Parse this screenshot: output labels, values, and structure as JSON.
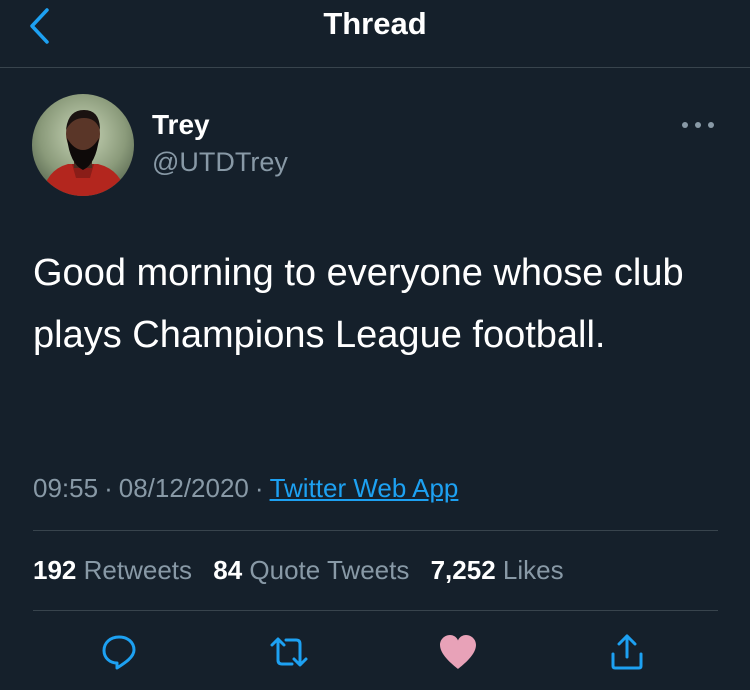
{
  "header": {
    "title": "Thread"
  },
  "author": {
    "name": "Trey",
    "handle": "@UTDTrey"
  },
  "tweet": {
    "text": "Good morning to everyone whose club plays Champions League football."
  },
  "meta": {
    "time": "09:55",
    "date": "08/12/2020",
    "source": "Twitter Web App",
    "separator": "·"
  },
  "stats": {
    "retweets": {
      "count": "192",
      "label": "Retweets"
    },
    "quotes": {
      "count": "84",
      "label": "Quote Tweets"
    },
    "likes": {
      "count": "7,252",
      "label": "Likes"
    }
  },
  "actions": {
    "reply_icon": "reply-icon",
    "retweet_icon": "retweet-icon",
    "like_icon": "heart-icon",
    "share_icon": "share-icon",
    "liked": true
  },
  "colors": {
    "background": "#15202b",
    "accent": "#1da1f2",
    "secondary_text": "#8899a6",
    "divider": "#38444d",
    "like_pink": "#e8a2b8"
  }
}
